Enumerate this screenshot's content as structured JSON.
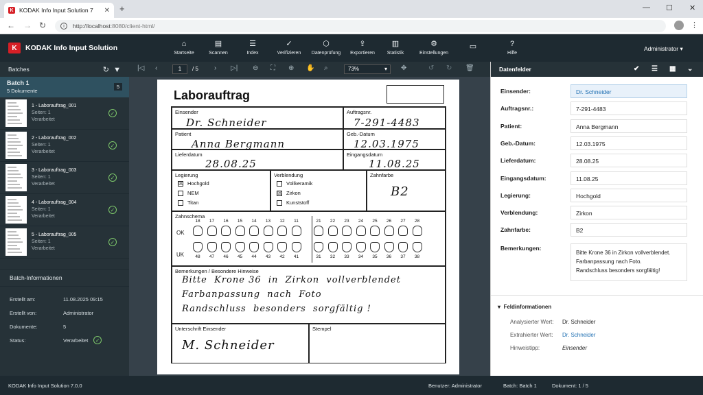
{
  "browser": {
    "tab_title": "KODAK Info Input Solution 7",
    "url_host": "http://localhost",
    "url_rest": ":8080/client-html/"
  },
  "app": {
    "title": "KODAK Info Input Solution",
    "menu": [
      {
        "label": "Startseite",
        "icon": "home-icon",
        "glyph": "⌂"
      },
      {
        "label": "Scannen",
        "icon": "scanner-icon",
        "glyph": "▤"
      },
      {
        "label": "Index",
        "icon": "list-icon",
        "glyph": "☰"
      },
      {
        "label": "Verifizieren",
        "icon": "verify-icon",
        "glyph": "✓"
      },
      {
        "label": "Datenprüfung",
        "icon": "box-icon",
        "glyph": "⬡"
      },
      {
        "label": "Exportieren",
        "icon": "export-icon",
        "glyph": "⇪"
      },
      {
        "label": "Statistik",
        "icon": "chart-icon",
        "glyph": "▥"
      },
      {
        "label": "Einstellungen",
        "icon": "gear-icon",
        "glyph": "⚙"
      },
      {
        "label": "",
        "icon": "monitor-icon",
        "glyph": "▭"
      },
      {
        "label": "Hilfe",
        "icon": "help-icon",
        "glyph": "?"
      }
    ],
    "user": "Administrator"
  },
  "left": {
    "header": "Batches",
    "batch_name": "Batch 1",
    "batch_count_label": "5 Dokumente",
    "batch_badge": "5",
    "documents": [
      {
        "name": "1 - Laborauftrag_001",
        "pages": "Seiten: 1",
        "status": "Verarbeitet"
      },
      {
        "name": "2 - Laborauftrag_002",
        "pages": "Seiten: 1",
        "status": "Verarbeitet"
      },
      {
        "name": "3 - Laborauftrag_003",
        "pages": "Seiten: 1",
        "status": "Verarbeitet"
      },
      {
        "name": "4 - Laborauftrag_004",
        "pages": "Seiten: 1",
        "status": "Verarbeitet"
      },
      {
        "name": "5 - Laborauftrag_005",
        "pages": "Seiten: 1",
        "status": "Verarbeitet"
      }
    ],
    "info_header": "Batch-Informationen",
    "info": [
      {
        "k": "Erstellt am:",
        "v": "11.08.2025 09:15"
      },
      {
        "k": "Erstellt von:",
        "v": "Administrator"
      },
      {
        "k": "Dokumente:",
        "v": "5"
      },
      {
        "k": "Status:",
        "v": "Verarbeitet"
      }
    ]
  },
  "viewer": {
    "page_current": "1",
    "page_total": "/ 5",
    "zoom": "73%"
  },
  "doc": {
    "title": "Laborauftrag",
    "labels": {
      "sender": "Einsender",
      "order_no": "Auftragsnr.",
      "patient": "Patient",
      "dob": "Geb.-Datum",
      "delivery": "Lieferdatum",
      "received": "Eingangsdatum",
      "alloy": "Legierung",
      "veneer": "Verblendung",
      "shade": "Zahnfarbe",
      "chart": "Zahnschema",
      "remarks": "Bemerkungen / Besondere Hinweise",
      "signature": "Unterschrift Einsender",
      "stamp": "Stempel",
      "ok": "OK",
      "uk": "UK"
    },
    "values": {
      "sender": "Dr. Schneider",
      "order_no": "7-291-4483",
      "patient": "Anna Bergmann",
      "dob": "12.03.1975",
      "delivery": "28.08.25",
      "received": "11.08.25",
      "shade": "B2",
      "signature": "M. Schneider"
    },
    "alloy_options": [
      {
        "label": "Hochgold",
        "mark": "☒"
      },
      {
        "label": "NEM",
        "mark": ""
      },
      {
        "label": "Titan",
        "mark": ""
      }
    ],
    "veneer_options": [
      {
        "label": "Vollkeramik",
        "mark": ""
      },
      {
        "label": "Zirkon",
        "mark": "☒"
      },
      {
        "label": "Kunststoff",
        "mark": ""
      }
    ],
    "upper_teeth": [
      "18",
      "17",
      "16",
      "15",
      "14",
      "13",
      "12",
      "11",
      "21",
      "22",
      "23",
      "24",
      "25",
      "26",
      "27",
      "28"
    ],
    "lower_teeth": [
      "48",
      "47",
      "46",
      "45",
      "44",
      "43",
      "42",
      "41",
      "31",
      "32",
      "33",
      "34",
      "35",
      "36",
      "37",
      "38"
    ],
    "remarks": [
      "Bitte  Krone 36  in  Zirkon  vollverblendet",
      "Farbanpassung  nach  Foto",
      "Randschluss  besonders  sorgfältig !"
    ]
  },
  "right": {
    "header": "Datenfelder",
    "fields": [
      {
        "label": "Einsender:",
        "value": "Dr. Schneider"
      },
      {
        "label": "Auftragsnr.:",
        "value": "7-291-4483"
      },
      {
        "label": "Patient:",
        "value": "Anna Bergmann"
      },
      {
        "label": "Geb.-Datum:",
        "value": "12.03.1975"
      },
      {
        "label": "Lieferdatum:",
        "value": "28.08.25"
      },
      {
        "label": "Eingangsdatum:",
        "value": "11.08.25"
      },
      {
        "label": "Legierung:",
        "value": "Hochgold"
      },
      {
        "label": "Verblendung:",
        "value": "Zirkon"
      },
      {
        "label": "Zahnfarbe:",
        "value": "B2"
      }
    ],
    "remarks_label": "Bemerkungen:",
    "remarks": [
      "Bitte Krone 36 in Zirkon vollverblendet.",
      "Farbanpassung nach Foto.",
      "Randschluss besonders sorgfältig!"
    ],
    "field_info_header": "Feldinformationen",
    "field_info": [
      {
        "k": "Analysierter Wert:",
        "v": "Dr. Schneider"
      },
      {
        "k": "Extrahierter Wert:",
        "v": "Dr. Schneider"
      },
      {
        "k": "Hinweistipp:",
        "v": "Einsender"
      }
    ],
    "accent": "#1f6fb2"
  },
  "status": {
    "version": "KODAK Info Input Solution 7.0.0",
    "user_label": "Benutzer:",
    "user": "Administrator",
    "batch_label": "Batch:",
    "batch": "Batch 1",
    "doc_label": "Dokument:",
    "doc": "1 / 5"
  }
}
